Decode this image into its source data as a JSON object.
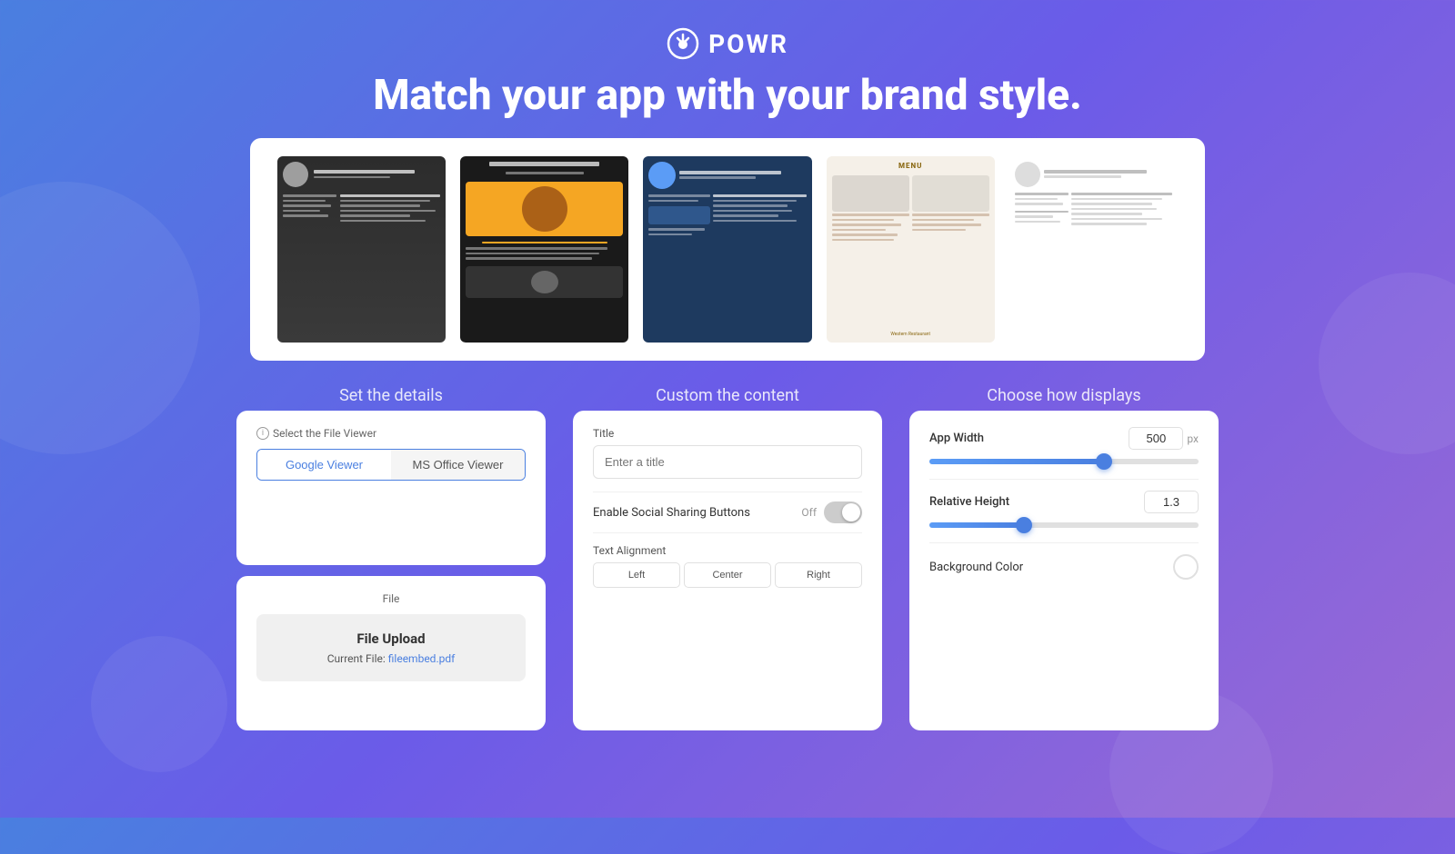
{
  "logo": {
    "text": "POWR"
  },
  "header": {
    "headline": "Match your app with your brand style."
  },
  "sections": {
    "set_details": "Set the details",
    "custom_content": "Custom the content",
    "choose_displays": "Choose how displays"
  },
  "file_viewer": {
    "label": "Select the File Viewer",
    "google_btn": "Google Viewer",
    "msoffice_btn": "MS Office Viewer"
  },
  "file": {
    "label": "File",
    "upload_label": "File Upload",
    "current_file_prefix": "Current File:",
    "current_file_name": "fileembed.pdf"
  },
  "content": {
    "title_label": "Title",
    "title_placeholder": "Enter a title",
    "social_label": "Enable Social Sharing Buttons",
    "social_state": "Off",
    "text_align_label": "Text Alignment",
    "align_left": "Left",
    "align_center": "Center",
    "align_right": "Right"
  },
  "display": {
    "app_width_label": "App Width",
    "app_width_value": "500",
    "app_width_unit": "px",
    "app_width_fill_pct": 65,
    "app_width_thumb_pct": 65,
    "relative_height_label": "Relative Height",
    "relative_height_value": "1.3",
    "relative_height_fill_pct": 35,
    "relative_height_thumb_pct": 35,
    "bg_color_label": "Background Color"
  }
}
